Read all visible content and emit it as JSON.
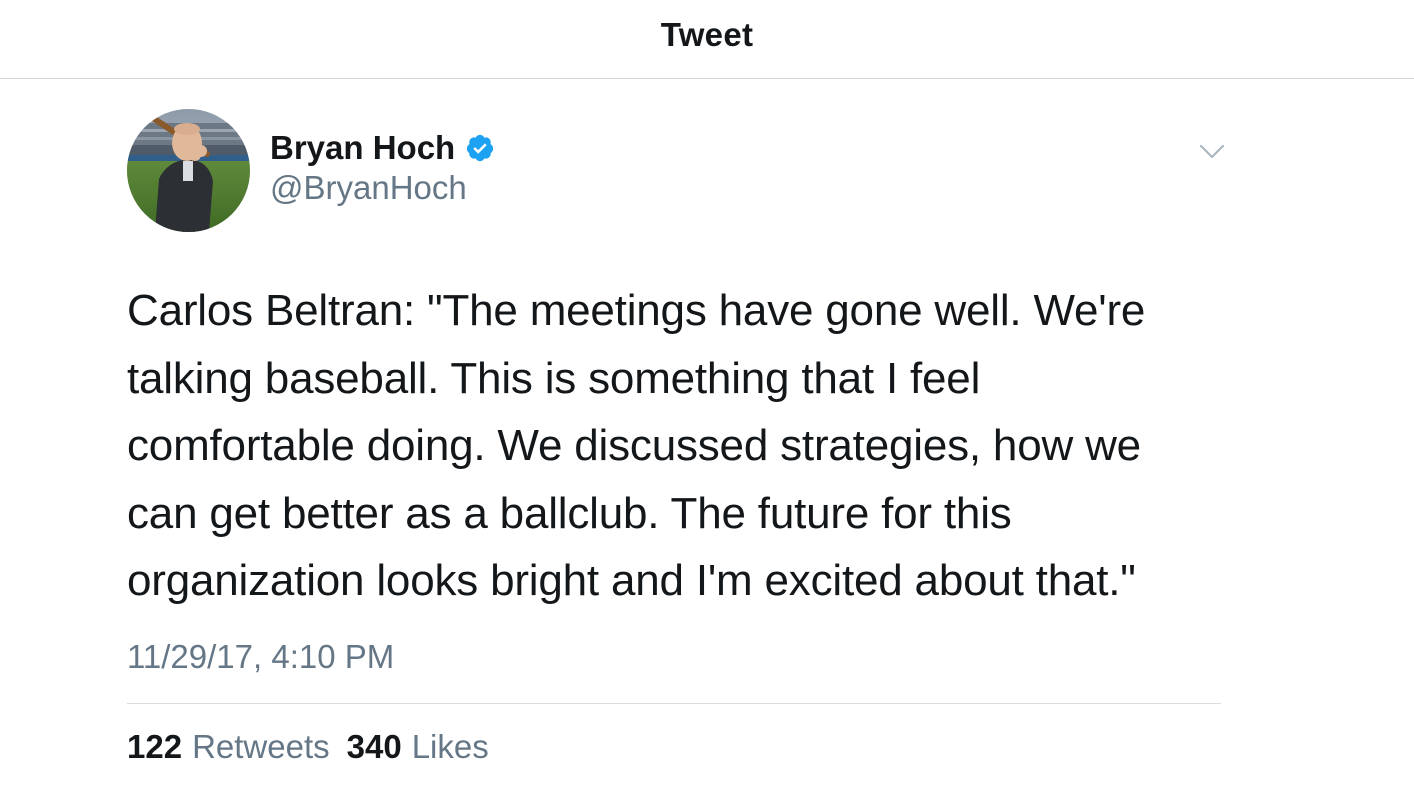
{
  "header": {
    "title": "Tweet"
  },
  "tweet": {
    "author": {
      "display_name": "Bryan Hoch",
      "handle": "@BryanHoch",
      "verified": true,
      "avatar_icon": "profile-photo"
    },
    "menu_icon": "chevron-down-icon",
    "text": "Carlos Beltran: \"The meetings have gone well. We're\ntalking baseball. This is something that I feel\ncomfortable doing. We discussed strategies, how we\ncan get better as a ballclub. The future for this\norganization looks bright and I'm excited about that.\"",
    "timestamp": "11/29/17, 4:10 PM",
    "stats": {
      "retweets_count": "122",
      "retweets_label": "Retweets",
      "likes_count": "340",
      "likes_label": "Likes"
    }
  },
  "colors": {
    "text_primary": "#14171a",
    "text_secondary": "#657786",
    "verified_blue": "#1da1f2",
    "divider": "#d8dde1"
  }
}
